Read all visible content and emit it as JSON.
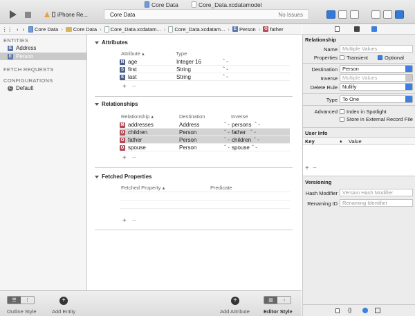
{
  "titlebar": {
    "tab_left": "Core Data",
    "tab_right": "Core_Data.xcdatamodel",
    "scheme_label": "iPhone Re...",
    "activity_left": "Core Data",
    "activity_right": "No Issues"
  },
  "jumpbar": {
    "items": [
      "Core Data",
      "Core Data",
      "Core_Data.xcdatam...",
      "Core_Data.xcdatam...",
      "Person",
      "father"
    ]
  },
  "sidebar": {
    "entities_header": "ENTITIES",
    "entities": [
      "Address",
      "Person"
    ],
    "fetch_header": "FETCH REQUESTS",
    "config_header": "CONFIGURATIONS",
    "configurations": [
      "Default"
    ]
  },
  "attributes": {
    "title": "Attributes",
    "col_attribute": "Attribute",
    "col_type": "Type",
    "rows": [
      {
        "icon": "N",
        "name": "age",
        "type": "Integer 16"
      },
      {
        "icon": "S",
        "name": "first",
        "type": "String"
      },
      {
        "icon": "S",
        "name": "last",
        "type": "String"
      }
    ]
  },
  "relationships": {
    "title": "Relationships",
    "col_relationship": "Relationship",
    "col_destination": "Destination",
    "col_inverse": "Inverse",
    "rows": [
      {
        "icon": "M",
        "name": "addresses",
        "destination": "Address",
        "inverse": "persons"
      },
      {
        "icon": "O",
        "name": "children",
        "destination": "Person",
        "inverse": "father"
      },
      {
        "icon": "O",
        "name": "father",
        "destination": "Person",
        "inverse": "children"
      },
      {
        "icon": "O",
        "name": "spouse",
        "destination": "Person",
        "inverse": "spouse"
      }
    ]
  },
  "fetched": {
    "title": "Fetched Properties",
    "col_property": "Fetched Property",
    "col_predicate": "Predicate"
  },
  "bottombar": {
    "outline_style": "Outline Style",
    "add_entity": "Add Entity",
    "add_attribute": "Add Attribute",
    "editor_style": "Editor Style"
  },
  "inspector": {
    "relationship_title": "Relationship",
    "name_label": "Name",
    "name_placeholder": "Multiple Values",
    "properties_label": "Properties",
    "transient_label": "Transient",
    "optional_label": "Optional",
    "destination_label": "Destination",
    "destination_value": "Person",
    "inverse_label": "Inverse",
    "inverse_value": "Multiple Values",
    "delete_rule_label": "Delete Rule",
    "delete_rule_value": "Nullify",
    "type_label": "Type",
    "type_value": "To One",
    "advanced_label": "Advanced",
    "index_label": "Index in Spotlight",
    "store_label": "Store in External Record File",
    "userinfo_title": "User Info",
    "key_label": "Key",
    "value_label": "Value",
    "versioning_title": "Versioning",
    "hash_label": "Hash Modifier",
    "hash_placeholder": "Version Hash Modifier",
    "renaming_label": "Renaming ID",
    "renaming_placeholder": "Renaming Identifier"
  }
}
